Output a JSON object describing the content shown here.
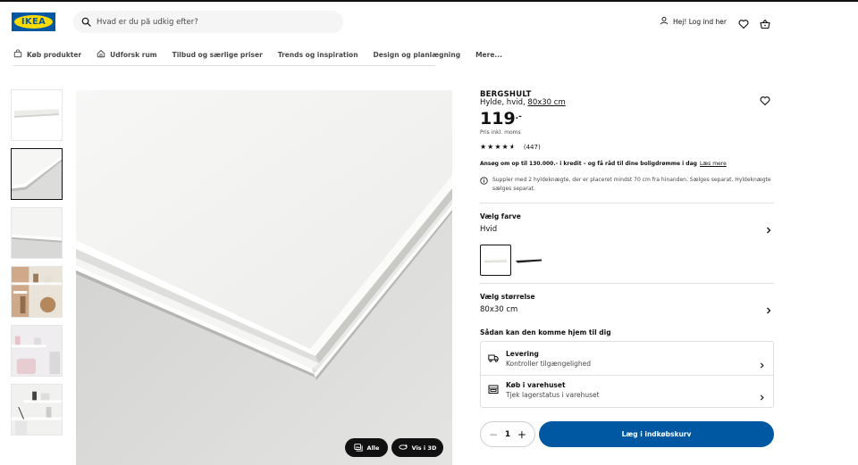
{
  "brand": {
    "logo_text": "IKEA",
    "blue": "#0058a3",
    "yellow": "#ffdb00"
  },
  "search": {
    "placeholder": "Hvad er du på udkig efter?"
  },
  "header": {
    "login_label": "Hej! Log ind her"
  },
  "nav": {
    "items": [
      {
        "label": "Køb produkter",
        "icon": "shop-icon"
      },
      {
        "label": "Udforsk rum",
        "icon": "home-icon"
      },
      {
        "label": "Tilbud og særlige priser"
      },
      {
        "label": "Trends og inspiration"
      },
      {
        "label": "Design og planlægning"
      },
      {
        "label": "Mere..."
      }
    ]
  },
  "gallery": {
    "thumbnail_count": 6,
    "selected_index": 1,
    "buttons": {
      "all_label": "Alle",
      "view3d_label": "Vis i 3D"
    }
  },
  "product": {
    "name": "BERGSHULT",
    "description": "Hylde, hvid,",
    "size_link": "80x30 cm",
    "price_main": "119",
    "price_suffix": ".-",
    "price_note": "Pris inkl. moms",
    "rating": 4.5,
    "rating_max": 5,
    "review_count": "(447)",
    "credit_text": "Ansøg om op til 130.000.- i kredit – og få råd til dine boligdrømme i dag",
    "credit_link": "Læs mere",
    "info_note": "Suppler med 2 hyldeknægte, der er placeret mindst 70 cm fra hinanden. Sælges separat. Hyldeknægte sælges separat."
  },
  "color": {
    "label": "Vælg farve",
    "value": "Hvid"
  },
  "size": {
    "label": "Vælg størrelse",
    "value": "80x30 cm"
  },
  "delivery": {
    "heading": "Sådan kan den komme hjem til dig",
    "options": [
      {
        "title": "Levering",
        "subtitle": "Kontroller tilgængelighed",
        "icon": "truck-icon"
      },
      {
        "title": "Køb i varehuset",
        "subtitle": "Tjek lagerstatus i varehuset",
        "icon": "store-icon"
      }
    ]
  },
  "purchase": {
    "quantity": "1",
    "minus": "−",
    "plus": "+",
    "cart_label": "Læg i indkøbskurv"
  }
}
